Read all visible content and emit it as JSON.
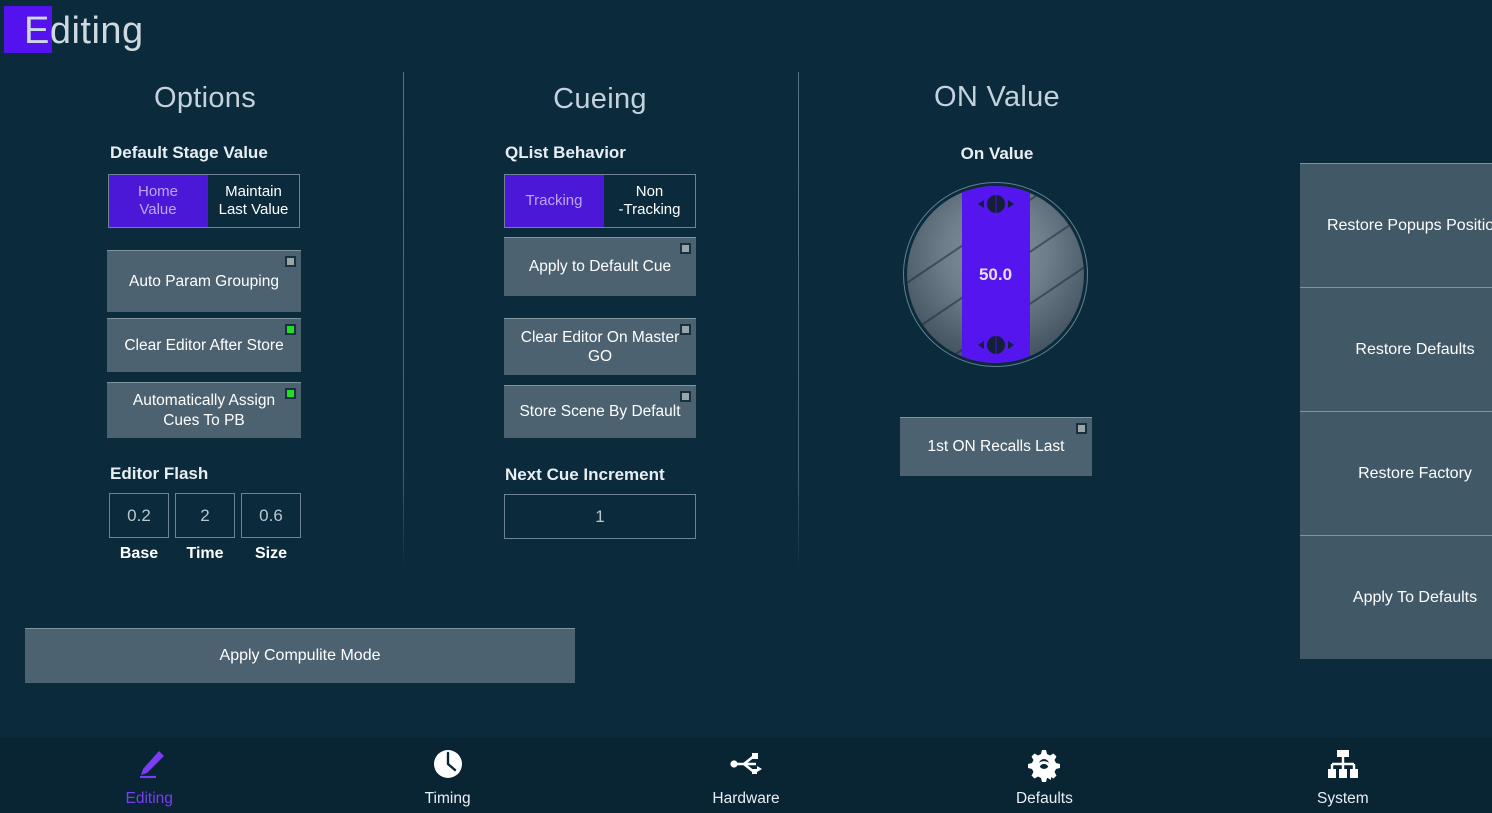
{
  "header": {
    "title": "Editing",
    "badge_color": "#5412ef"
  },
  "columns": {
    "options": {
      "heading": "Options"
    },
    "cueing": {
      "heading": "Cueing"
    },
    "on_value": {
      "heading": "ON Value"
    }
  },
  "options": {
    "default_stage_value": {
      "label": "Default Stage Value",
      "segments": [
        {
          "label": "Home Value",
          "line1": "Home",
          "line2": "Value",
          "selected": true
        },
        {
          "label": "Maintain Last Value",
          "line1": "Maintain",
          "line2": "Last Value",
          "selected": false
        }
      ]
    },
    "toggles": [
      {
        "label": "Auto Param Grouping",
        "led": "off"
      },
      {
        "label": "Clear Editor After Store",
        "led": "on"
      },
      {
        "label": "Automatically Assign Cues To PB",
        "line1": "Automatically Assign",
        "line2": "Cues To PB",
        "led": "on"
      }
    ],
    "editor_flash": {
      "label": "Editor Flash",
      "fields": [
        {
          "value": "0.2",
          "caption": "Base"
        },
        {
          "value": "2",
          "caption": "Time"
        },
        {
          "value": "0.6",
          "caption": "Size"
        }
      ]
    }
  },
  "cueing": {
    "qlist_behavior": {
      "label": "QList Behavior",
      "segments": [
        {
          "label": "Tracking",
          "line1": "Tracking",
          "line2": "",
          "selected": true
        },
        {
          "label": "Non-Tracking",
          "line1": "Non",
          "line2": "-Tracking",
          "selected": false
        }
      ]
    },
    "toggles": [
      {
        "label": "Apply to Default Cue",
        "led": "off"
      },
      {
        "label": "Clear Editor On Master GO",
        "line1": "Clear Editor On Master",
        "line2": "GO",
        "led": "off"
      },
      {
        "label": "Store Scene By Default",
        "led": "off"
      }
    ],
    "next_cue_increment": {
      "label": "Next Cue Increment",
      "value": "1"
    }
  },
  "on_value": {
    "knob_label": "On Value",
    "knob_value": "50.0",
    "knob_accent": "#5515ef",
    "toggle": {
      "label": "1st ON Recalls Last",
      "led": "off"
    }
  },
  "actions": {
    "apply_compulite_mode": "Apply Compulite Mode"
  },
  "sidebar": {
    "buttons": [
      {
        "label": "Restore Popups Position"
      },
      {
        "label": "Restore Defaults"
      },
      {
        "label": "Restore Factory"
      },
      {
        "label": "Apply To Defaults"
      }
    ]
  },
  "navbar": {
    "items": [
      {
        "label": "Editing",
        "icon": "pencil-icon",
        "active": true
      },
      {
        "label": "Timing",
        "icon": "clock-icon",
        "active": false
      },
      {
        "label": "Hardware",
        "icon": "usb-icon",
        "active": false
      },
      {
        "label": "Defaults",
        "icon": "gear-refresh-icon",
        "active": false
      },
      {
        "label": "System",
        "icon": "hierarchy-icon",
        "active": false
      }
    ]
  }
}
